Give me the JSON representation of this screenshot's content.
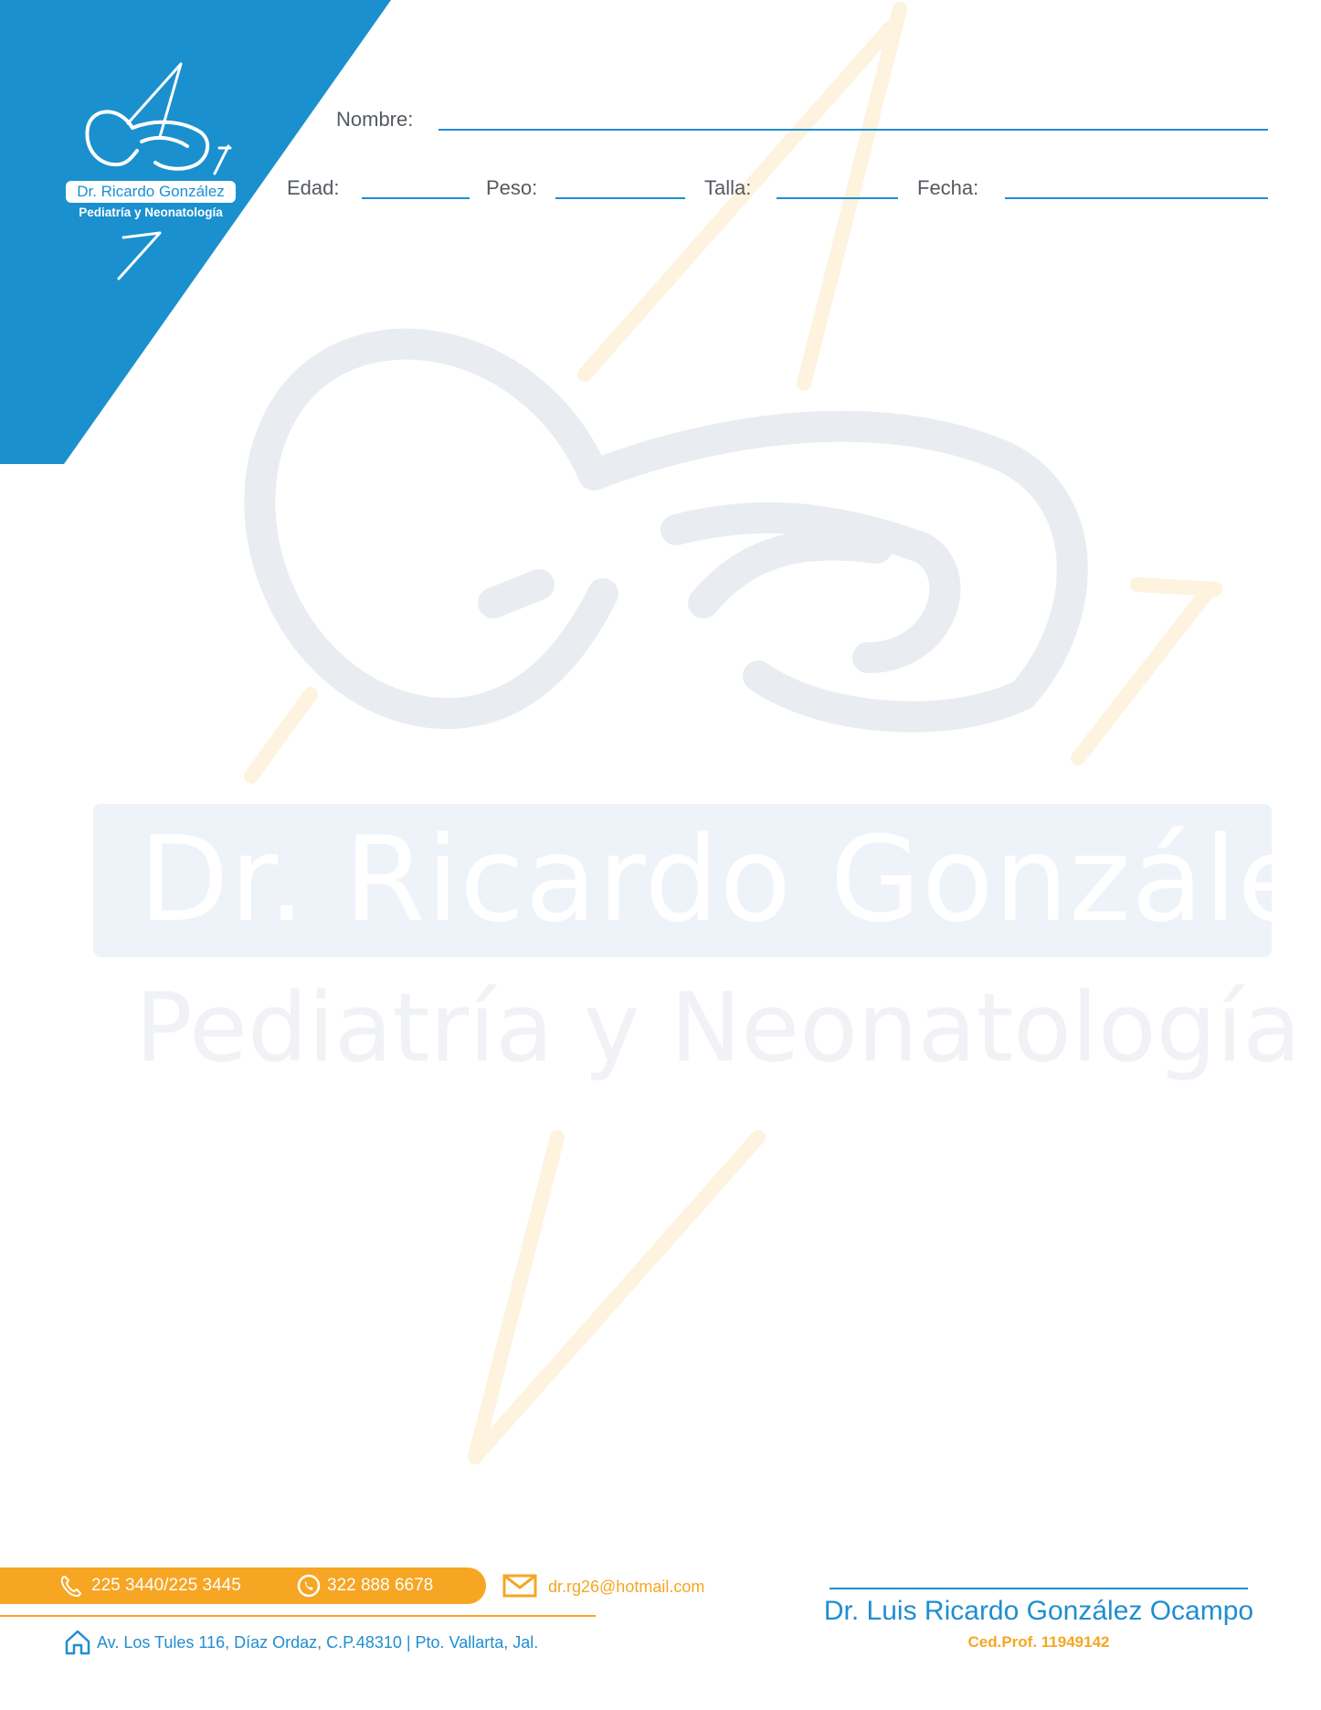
{
  "colors": {
    "brand_blue": "#1a90cf",
    "accent_orange": "#f6a623",
    "label_gray": "#555a60"
  },
  "logo": {
    "name": "Dr. Ricardo González",
    "subtitle": "Pediatría y Neonatología",
    "icon": "sleeping-baby-icon"
  },
  "watermark": {
    "title": "Dr. Ricardo González",
    "subtitle": "Pediatría y Neonatología",
    "icon": "sleeping-baby-icon"
  },
  "form": {
    "nombre_label": "Nombre:",
    "edad_label": "Edad:",
    "peso_label": "Peso:",
    "talla_label": "Talla:",
    "fecha_label": "Fecha:"
  },
  "footer": {
    "phone_icon": "phone-icon",
    "phone": "225 3440/225 3445",
    "whatsapp_icon": "whatsapp-icon",
    "mobile": "322 888 6678",
    "email_icon": "envelope-icon",
    "email": "dr.rg26@hotmail.com",
    "home_icon": "home-icon",
    "address": "Av. Los Tules 116, Díaz Ordaz, C.P.48310 | Pto. Vallarta, Jal.",
    "signature_name": "Dr. Luis Ricardo González Ocampo",
    "cedula": "Ced.Prof. 11949142"
  }
}
